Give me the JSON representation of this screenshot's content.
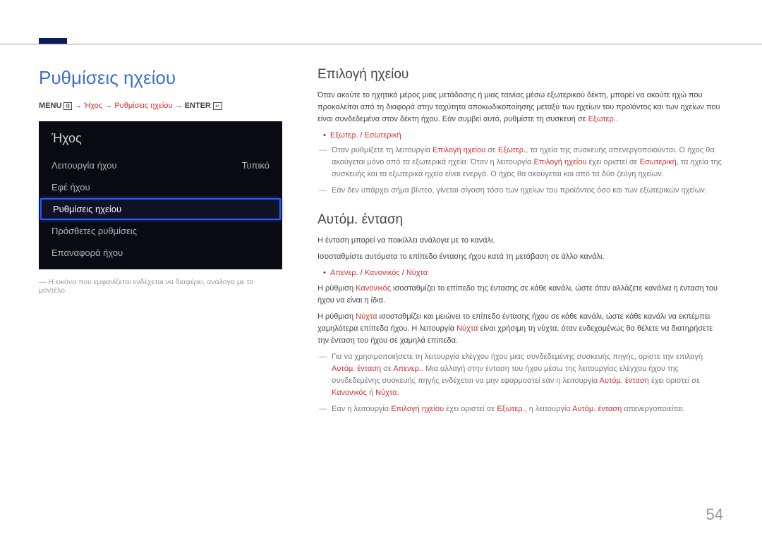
{
  "leftTitle": "Ρυθμίσεις ηχείου",
  "breadcrumb": {
    "menu": "MENU",
    "arrow": "→",
    "p1": "Ήχος",
    "p2": "Ρυθμίσεις ηχείου",
    "enter": "ENTER"
  },
  "osd": {
    "title": "Ήχος",
    "rows": [
      {
        "label": "Λειτουργία ήχου",
        "value": "Τυπικό",
        "selected": false
      },
      {
        "label": "Εφέ ήχου",
        "value": "",
        "selected": false
      },
      {
        "label": "Ρυθμίσεις ηχείου",
        "value": "",
        "selected": true
      },
      {
        "label": "Πρόσθετες ρυθμίσεις",
        "value": "",
        "selected": false
      },
      {
        "label": "Επαναφορά ήχου",
        "value": "",
        "selected": false
      }
    ]
  },
  "caption": "― Η εικόνα που εμφανίζεται ενδέχεται να διαφέρει, ανάλογα με το μοντέλο.",
  "section1": {
    "title": "Επιλογή ηχείου",
    "intro_a": "Όταν ακούτε το ηχητικό μέρος μιας μετάδοσης ή μιας ταινίας μέσω εξωτερικού δέκτη, μπορεί να ακούτε ηχώ που προκαλείται από τη διαφορά στην ταχύτητα αποκωδικοποίησης μεταξύ των ηχείων του προϊόντος και των ηχείων που είναι συνδεδεμένα στον δέκτη ήχου. Εάν συμβεί αυτό, ρυθμίστε τη συσκευή σε ",
    "intro_red": "Εξωτερ.",
    "intro_b": ".",
    "bullet1_a": "Εξωτερ.",
    "bullet1_sep": " / ",
    "bullet1_b": "Εσωτερική",
    "note1_a": "Όταν ρυθμίζετε τη λειτουργία ",
    "note1_r1": "Επιλογή ηχείου",
    "note1_b": " σε ",
    "note1_r2": "Εξωτερ.",
    "note1_c": ", τα ηχεία της συσκευής απενεργοποιούνται. Ο ήχος θα ακούγεται μόνο από τα εξωτερικά ηχεία. Όταν η λειτουργία ",
    "note1_r3": "Επιλογή ηχείου",
    "note1_d": " έχει οριστεί σε ",
    "note1_r4": "Εσωτερική",
    "note1_e": ", τα ηχεία της συσκευής και τα εξωτερικά ηχεία είναι ενεργά. Ο ήχος θα ακούγεται και από τα δύο ζεύγη ηχείων.",
    "note2": "Εάν δεν υπάρχει σήμα βίντεο, γίνεται σίγαση τόσο των ηχείων του προϊόντος όσο και των εξωτερικών ηχείων."
  },
  "section2": {
    "title": "Αυτόμ. ένταση",
    "p1": "Η ένταση μπορεί να ποικίλλει ανάλογα με το κανάλι.",
    "p2": "Ισοσταθμίστε αυτόματα το επίπεδο έντασης ήχου κατά τη μετάβαση σε άλλο κανάλι.",
    "bullet_a": "Απενερ.",
    "bullet_b": "Κανονικός",
    "bullet_c": "Νύχτα",
    "sep": " / ",
    "p3_a": "Η ρύθμιση ",
    "p3_r1": "Κανονικός",
    "p3_b": " ισοσταθμίζει το επίπεδο της έντασης σε κάθε κανάλι, ώστε όταν αλλάζετε κανάλια η ένταση του ήχου να είναι η ίδια.",
    "p4_a": "Η ρύθμιση ",
    "p4_r1": "Νύχτα",
    "p4_b": " ισοσταθμίζει και μειώνει το επίπεδο έντασης ήχου σε κάθε κανάλι, ώστε κάθε κανάλι να εκπέμπει χαμηλότερα επίπεδα ήχου. Η λειτουργία ",
    "p4_r2": "Νύχτα",
    "p4_c": " είναι χρήσιμη τη νύχτα, όταν ενδεχομένως θα θέλετε να διατηρήσετε την ένταση του ήχου σε χαμηλά επίπεδα.",
    "note1_a": "Για να χρησιμοποιήσετε τη λειτουργία ελέγχου ήχου μιας συνδεδεμένης συσκευής πηγής, ορίστε την επιλογή ",
    "note1_r1": "Αυτόμ. ένταση",
    "note1_b": " σε ",
    "note1_r2": "Απενερ.",
    "note1_c": ". Μια αλλαγή στην ένταση του ήχου μέσω της λειτουργίας ελέγχου ήχου της συνδεδεμένης συσκευής πηγής ενδέχεται να μην εφαρμοστεί εάν η λειτουργία ",
    "note1_r3": "Αυτόμ. ένταση",
    "note1_d": " έχει οριστεί σε ",
    "note1_r4": "Κανονικός",
    "note1_e": " ή ",
    "note1_r5": "Νύχτα",
    "note1_f": ".",
    "note2_a": "Εάν η λειτουργία ",
    "note2_r1": "Επιλογή ηχείου",
    "note2_b": " έχει οριστεί σε ",
    "note2_r2": "Εξωτερ.",
    "note2_c": ", η λειτουργία ",
    "note2_r3": "Αυτόμ. ένταση",
    "note2_d": " απενεργοποιείται."
  },
  "pageNumber": "54"
}
